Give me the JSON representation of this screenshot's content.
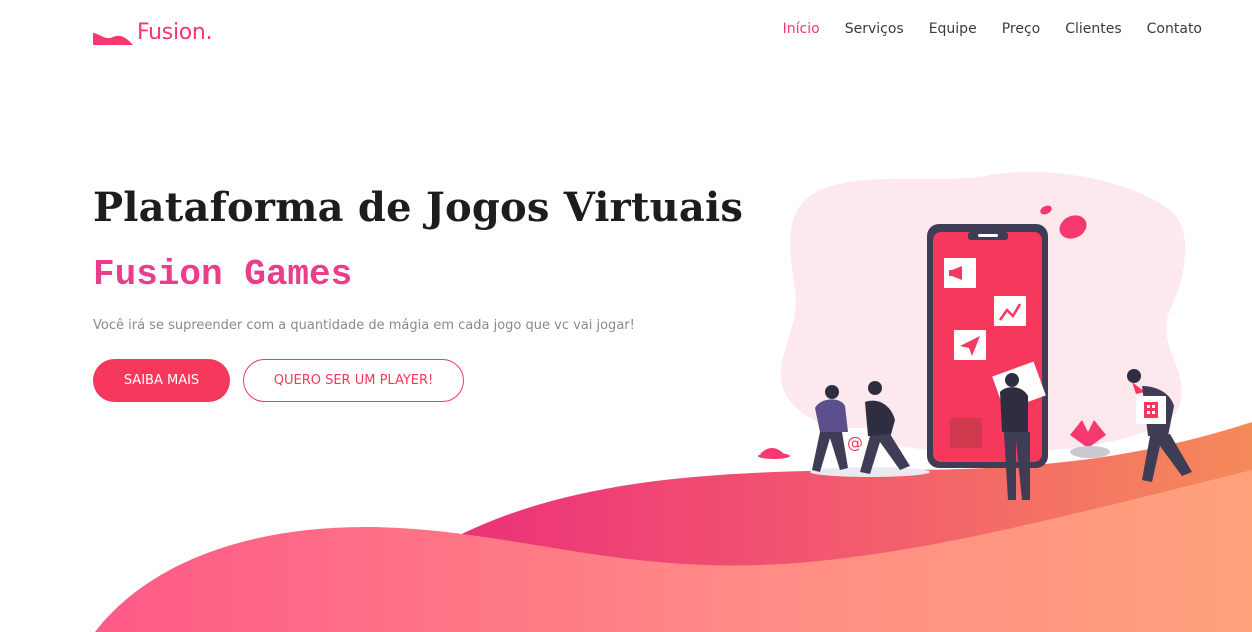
{
  "header": {
    "logo_text": "Fusion.",
    "nav": [
      {
        "label": "Início",
        "active": true
      },
      {
        "label": "Serviços",
        "active": false
      },
      {
        "label": "Equipe",
        "active": false
      },
      {
        "label": "Preço",
        "active": false
      },
      {
        "label": "Clientes",
        "active": false
      },
      {
        "label": "Contato",
        "active": false
      }
    ]
  },
  "hero": {
    "title": "Plataforma de Jogos Virtuais",
    "subtitle": "Fusion Games",
    "description": "Você irá se supreender com a quantidade de mágia em cada jogo que vc vai jogar!",
    "primary_button": "SAIBA MAIS",
    "secondary_button": "QUERO SER UM PLAYER!"
  },
  "colors": {
    "accent": "#f5386e",
    "subtitle": "#e83e8c",
    "title": "#1d1d1d",
    "text": "#8a8a8a"
  },
  "icons": [
    "megaphone-icon",
    "chart-icon",
    "send-icon",
    "at-icon",
    "building-icon"
  ]
}
